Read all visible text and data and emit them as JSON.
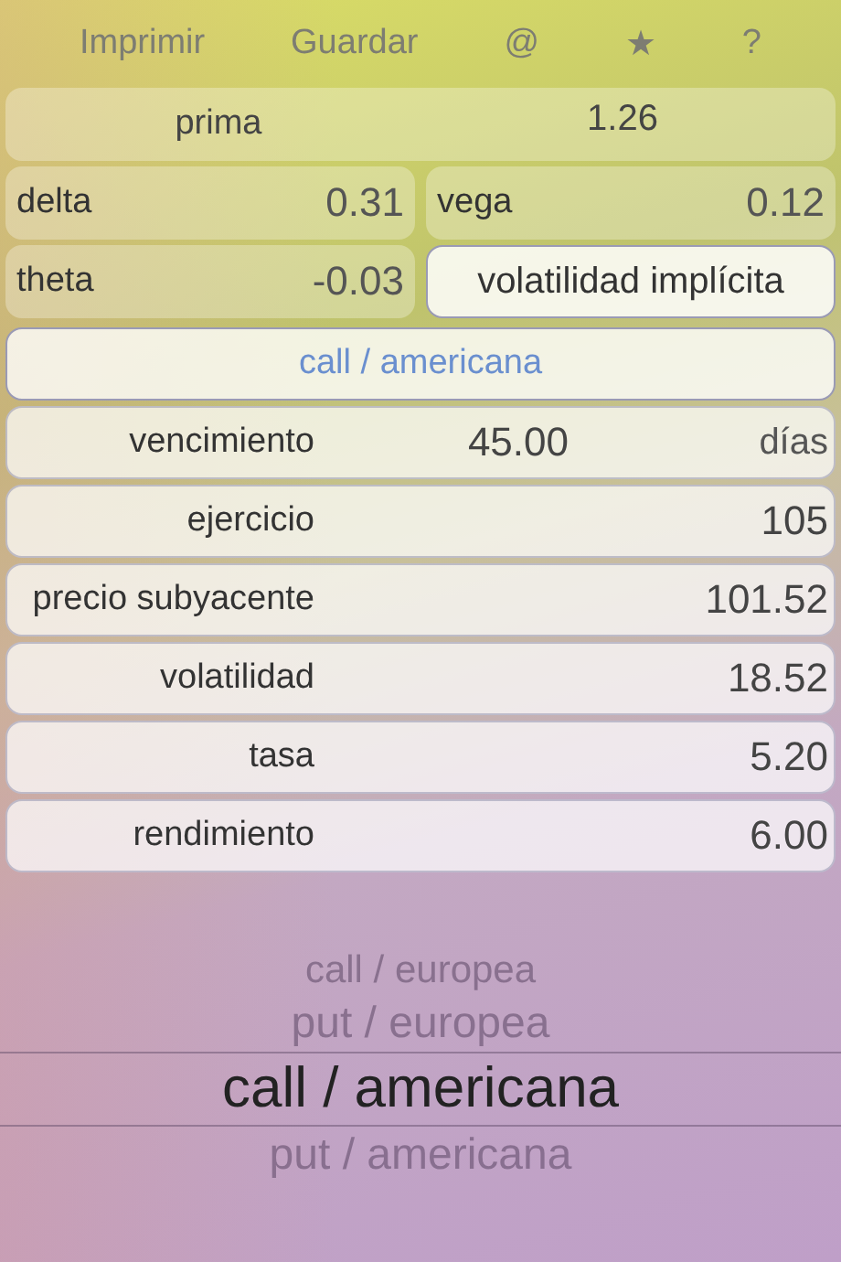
{
  "toolbar": [
    {
      "label": "Imprimir"
    },
    {
      "label": "Guardar"
    },
    {
      "label": "@"
    },
    {
      "label": "★"
    },
    {
      "label": "?"
    }
  ],
  "premium": {
    "label": "prima",
    "value": "1.26"
  },
  "greeks": [
    {
      "label": "delta",
      "value": "0.31"
    },
    {
      "label": "vega",
      "value": "0.12"
    },
    {
      "label": "theta",
      "value": "-0.03"
    }
  ],
  "implied_volatility_button": "volatilidad implícita",
  "option_type_button": "call / americana",
  "inputs": [
    {
      "label": "vencimiento",
      "value": "45.00",
      "unit": "días"
    },
    {
      "label": "ejercicio",
      "value": "105"
    },
    {
      "label": "precio subyacente",
      "value": "101.52"
    },
    {
      "label": "volatilidad",
      "value": "18.52"
    },
    {
      "label": "tasa",
      "value": "5.20"
    },
    {
      "label": "rendimiento",
      "value": "6.00"
    }
  ],
  "picker": [
    {
      "label": "call / europea",
      "selected": false
    },
    {
      "label": "put / europea",
      "selected": false
    },
    {
      "label": "call / americana",
      "selected": true
    },
    {
      "label": "put / americana",
      "selected": false
    }
  ]
}
